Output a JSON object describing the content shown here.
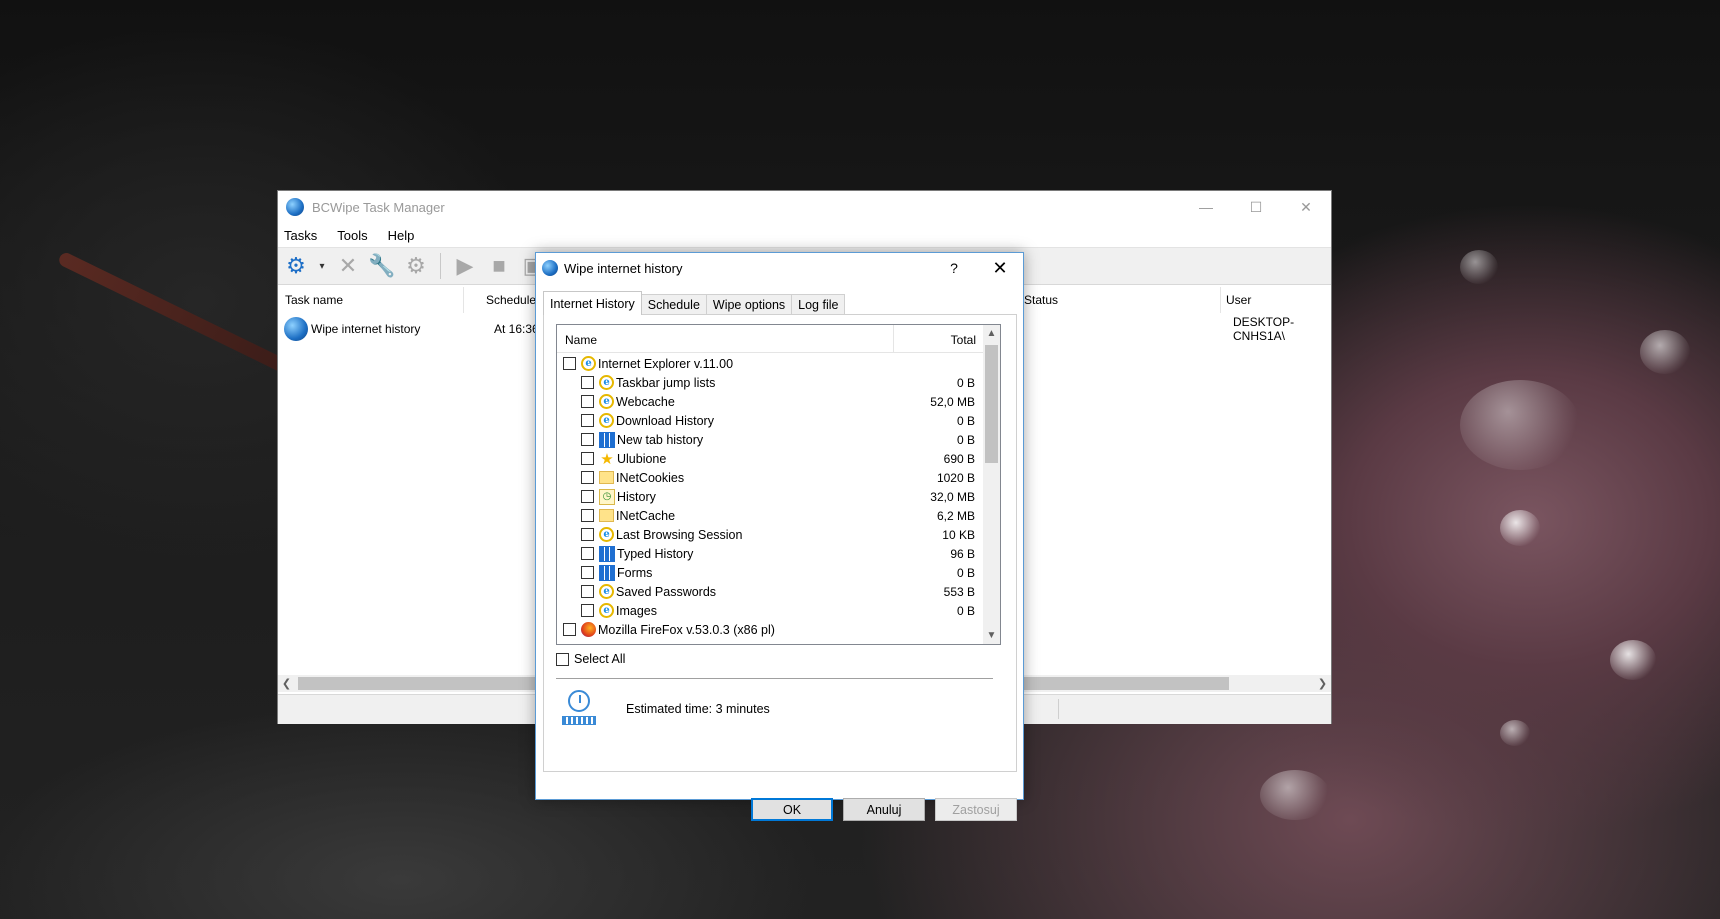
{
  "main_window": {
    "title": "BCWipe Task Manager",
    "menu": [
      {
        "label": "Tasks"
      },
      {
        "label": "Tools"
      },
      {
        "label": "Help"
      }
    ],
    "columns": {
      "task_name": "Task name",
      "schedule": "Schedule",
      "status": "Status",
      "user": "User"
    },
    "task_row": {
      "name": "Wipe internet history",
      "schedule": "At 16:36",
      "user": "DESKTOP-CNHS1A\\"
    }
  },
  "dialog": {
    "title": "Wipe internet history",
    "help_glyph": "?",
    "tabs": [
      {
        "label": "Internet History",
        "active": true
      },
      {
        "label": "Schedule"
      },
      {
        "label": "Wipe options"
      },
      {
        "label": "Log file"
      }
    ],
    "tree": {
      "col_name": "Name",
      "col_total": "Total",
      "items": [
        {
          "label": "Internet Explorer v.11.00",
          "size": "",
          "level": 0,
          "icon": "ie-icon"
        },
        {
          "label": "Taskbar jump lists",
          "size": "0 B",
          "level": 1,
          "icon": "ie-icon"
        },
        {
          "label": "Webcache",
          "size": "52,0 MB",
          "level": 1,
          "icon": "ie-icon"
        },
        {
          "label": "Download History",
          "size": "0 B",
          "level": 1,
          "icon": "ie-icon"
        },
        {
          "label": "New tab history",
          "size": "0 B",
          "level": 1,
          "icon": "grid-icon"
        },
        {
          "label": "Ulubione",
          "size": "690 B",
          "level": 1,
          "icon": "star-icon"
        },
        {
          "label": "INetCookies",
          "size": "1020 B",
          "level": 1,
          "icon": "folder-icon"
        },
        {
          "label": "History",
          "size": "32,0 MB",
          "level": 1,
          "icon": "history-icon"
        },
        {
          "label": "INetCache",
          "size": "6,2 MB",
          "level": 1,
          "icon": "folder-icon"
        },
        {
          "label": "Last Browsing Session",
          "size": "10 KB",
          "level": 1,
          "icon": "ie-icon"
        },
        {
          "label": "Typed History",
          "size": "96 B",
          "level": 1,
          "icon": "grid-icon"
        },
        {
          "label": "Forms",
          "size": "0 B",
          "level": 1,
          "icon": "grid-icon"
        },
        {
          "label": "Saved Passwords",
          "size": "553 B",
          "level": 1,
          "icon": "ie-icon"
        },
        {
          "label": "Images",
          "size": "0 B",
          "level": 1,
          "icon": "ie-icon"
        },
        {
          "label": "Mozilla FireFox v.53.0.3 (x86 pl)",
          "size": "",
          "level": 0,
          "icon": "firefox-icon"
        }
      ]
    },
    "select_all": "Select All",
    "estimated_time": "Estimated time: 3 minutes",
    "buttons": {
      "ok": "OK",
      "cancel": "Anuluj",
      "apply": "Zastosuj"
    }
  },
  "colors": {
    "accent": "#0078d7",
    "dialog_border": "#5b9bd5"
  }
}
